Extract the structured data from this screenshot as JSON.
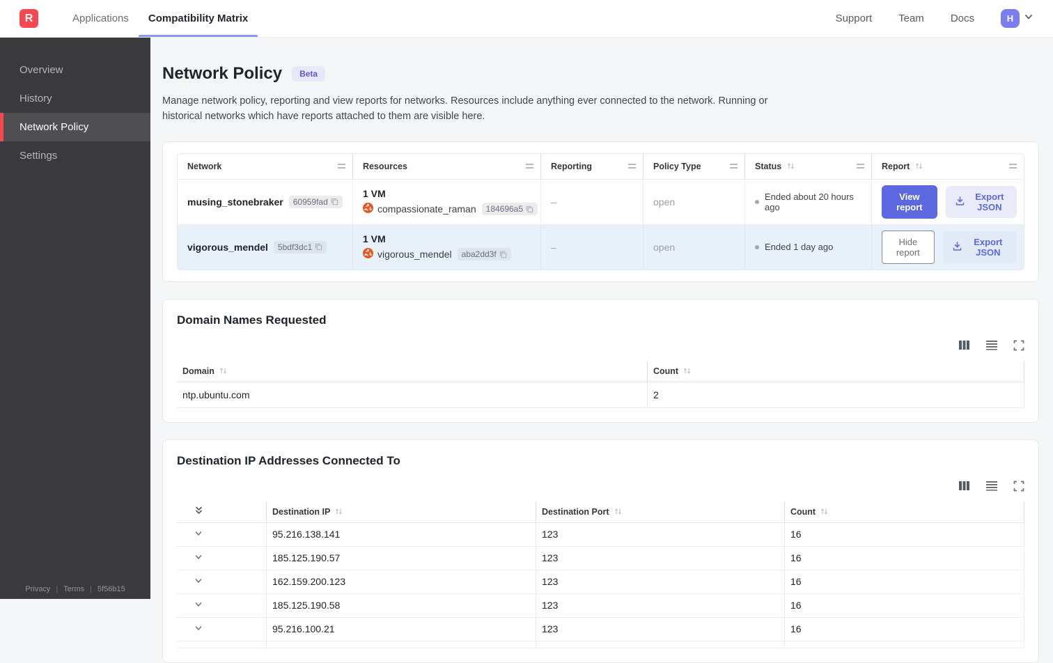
{
  "topnav": {
    "logo_letter": "R",
    "tabs": [
      {
        "label": "Applications",
        "active": false
      },
      {
        "label": "Compatibility Matrix",
        "active": true
      }
    ],
    "links": [
      "Support",
      "Team",
      "Docs"
    ],
    "avatar_letter": "H"
  },
  "sidebar": {
    "items": [
      {
        "label": "Overview",
        "active": false
      },
      {
        "label": "History",
        "active": false
      },
      {
        "label": "Network Policy",
        "active": true
      },
      {
        "label": "Settings",
        "active": false
      }
    ],
    "footer": {
      "privacy": "Privacy",
      "terms": "Terms",
      "version": "5f56b15"
    }
  },
  "page": {
    "title": "Network Policy",
    "badge": "Beta",
    "description": "Manage network policy, reporting and view reports for networks. Resources include anything ever connected to the network. Running or historical networks which have reports attached to them are visible here."
  },
  "networks_table": {
    "columns": [
      {
        "label": "Network",
        "sortable": false
      },
      {
        "label": "Resources",
        "sortable": false
      },
      {
        "label": "Reporting",
        "sortable": false
      },
      {
        "label": "Policy Type",
        "sortable": false
      },
      {
        "label": "Status",
        "sortable": true
      },
      {
        "label": "Report",
        "sortable": true
      }
    ],
    "rows": [
      {
        "network_name": "musing_stonebraker",
        "network_id": "60959fad",
        "resources_summary": "1 VM",
        "resource_name": "compassionate_raman",
        "resource_id": "184696a5",
        "reporting": "–",
        "policy_type": "open",
        "status": "Ended about 20 hours ago",
        "report_button": "View report",
        "export_button": "Export JSON",
        "selected": false
      },
      {
        "network_name": "vigorous_mendel",
        "network_id": "5bdf3dc1",
        "resources_summary": "1 VM",
        "resource_name": "vigorous_mendel",
        "resource_id": "aba2dd3f",
        "reporting": "–",
        "policy_type": "open",
        "status": "Ended 1 day ago",
        "report_button": "Hide report",
        "export_button": "Export JSON",
        "selected": true
      }
    ]
  },
  "domains_card": {
    "title": "Domain Names Requested",
    "columns": [
      {
        "label": "Domain",
        "sortable": true
      },
      {
        "label": "Count",
        "sortable": true
      }
    ],
    "rows": [
      {
        "domain": "ntp.ubuntu.com",
        "count": "2"
      }
    ]
  },
  "destinations_card": {
    "title": "Destination IP Addresses Connected To",
    "columns": [
      {
        "label": "Destination IP",
        "sortable": true
      },
      {
        "label": "Destination Port",
        "sortable": true
      },
      {
        "label": "Count",
        "sortable": true
      }
    ],
    "rows": [
      {
        "ip": "95.216.138.141",
        "port": "123",
        "count": "16"
      },
      {
        "ip": "185.125.190.57",
        "port": "123",
        "count": "16"
      },
      {
        "ip": "162.159.200.123",
        "port": "123",
        "count": "16"
      },
      {
        "ip": "185.125.190.58",
        "port": "123",
        "count": "16"
      },
      {
        "ip": "95.216.100.21",
        "port": "123",
        "count": "16"
      }
    ]
  },
  "icons": {
    "logo": "app-logo",
    "avatar_chevron": "chevron-down-icon",
    "copy": "copy-icon",
    "ubuntu": "ubuntu-logo-icon",
    "sort": "sort-arrows-icon",
    "column_resize": "column-resize-handle-icon",
    "columns_toggle": "columns-icon",
    "row_density": "row-density-icon",
    "fullscreen": "fullscreen-icon",
    "expand_all": "double-chevron-down-icon",
    "row_expand": "chevron-down-icon",
    "download": "download-icon",
    "status_dot": "status-dot"
  },
  "colors": {
    "brand_red": "#f6484f",
    "accent_indigo": "#5b68e0",
    "tab_underline": "#8a97f6",
    "avatar_bg": "#7b7ef0",
    "sidebar_bg": "#3a3a3c",
    "sidebar_active_bg": "#4f4f52",
    "selected_row_bg": "#e8f0fa",
    "page_bg": "#f5f6f8",
    "beta_badge_bg": "#e9e8fb",
    "beta_badge_text": "#5d5ace",
    "ubuntu_orange": "#e95420"
  }
}
